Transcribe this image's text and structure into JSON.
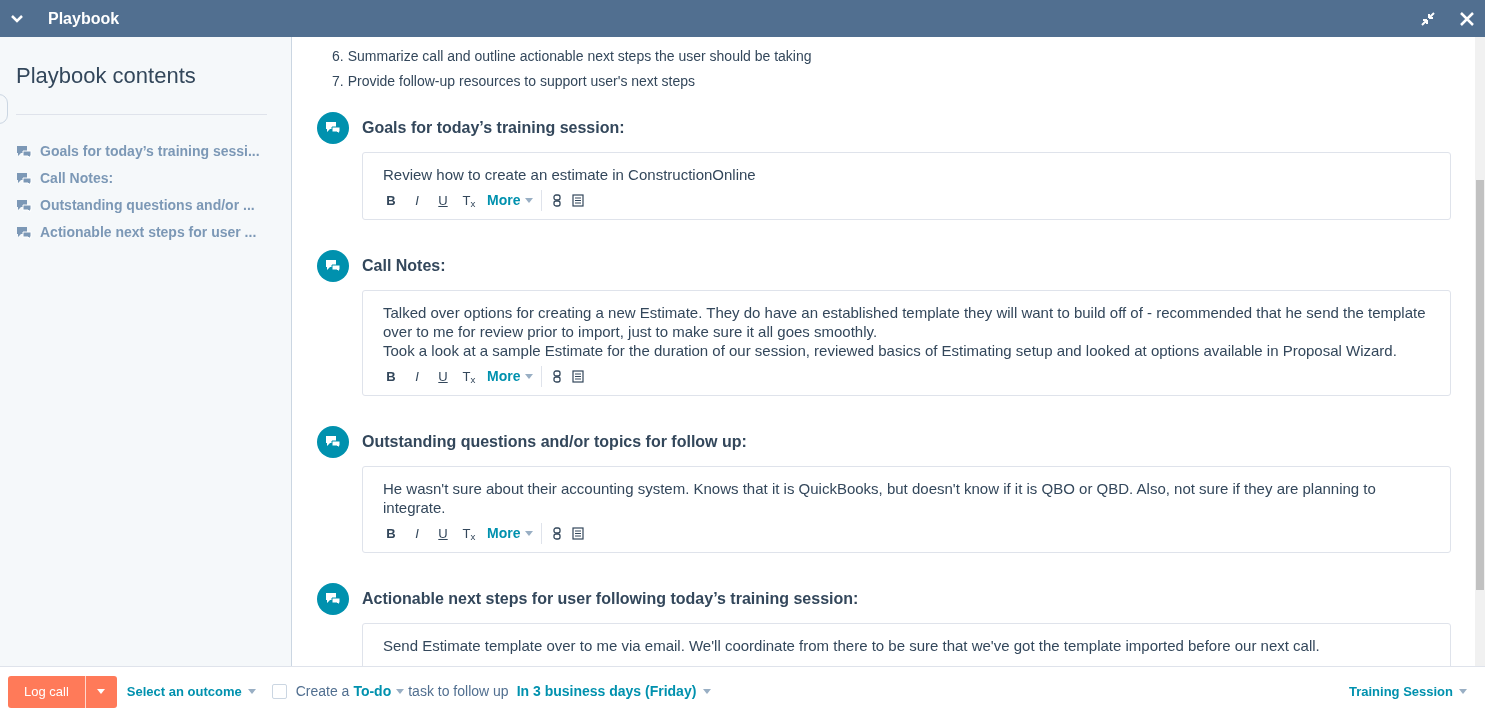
{
  "window": {
    "title": "Playbook"
  },
  "sidebar": {
    "title": "Playbook contents",
    "items": [
      {
        "label": "Goals for today’s training sessi..."
      },
      {
        "label": "Call Notes:"
      },
      {
        "label": "Outstanding questions and/or ..."
      },
      {
        "label": "Actionable next steps for user ..."
      }
    ]
  },
  "intro_list": [
    {
      "number": "6.",
      "text": "Summarize call and outline actionable next steps the user should be taking"
    },
    {
      "number": "7.",
      "text": "Provide follow-up resources to support user's next steps"
    }
  ],
  "sections": [
    {
      "question": "Goals for today’s training session:",
      "answer": [
        "Review how to create an estimate in ConstructionOnline"
      ],
      "toolbar": {
        "buttons": [
          "B",
          "I",
          "U",
          "T$_{x}$"
        ],
        "more": "More"
      }
    },
    {
      "question": "Call Notes:",
      "answer": [
        "Talked over options for creating a new Estimate. They do have an established template they will want to build off of - recommended that he send the template over to me for review prior to import, just to make sure it all goes smoothly.",
        "Took a look at a sample Estimate for the duration of our session, reviewed basics of Estimating setup and looked at options available in Proposal Wizard."
      ],
      "toolbar": {
        "buttons": [
          "B",
          "I",
          "U",
          "T$_{x}$"
        ],
        "more": "More"
      }
    },
    {
      "question": "Outstanding questions and/or topics for follow up:",
      "answer": [
        "He wasn't sure about their accounting system. Knows that it is QuickBooks, but doesn't know if it is QBO or QBD. Also, not sure if they are planning to integrate."
      ],
      "toolbar": {
        "buttons": [
          "B",
          "I",
          "U",
          "T$_{x}$"
        ],
        "more": "More"
      }
    },
    {
      "question": "Actionable next steps for user following today’s training session:",
      "answer": [
        "Send Estimate template over to me via email. We'll coordinate from there to be sure that we've got the template imported before our next call."
      ]
    }
  ],
  "footer": {
    "log_button": "Log call",
    "outcome": "Select an outcome",
    "task_checked": false,
    "task_prefix": "Create a",
    "task_type": "To-do",
    "task_middle": "task to follow up",
    "due": "In 3 business days (Friday)",
    "call_type": "Training Session"
  }
}
